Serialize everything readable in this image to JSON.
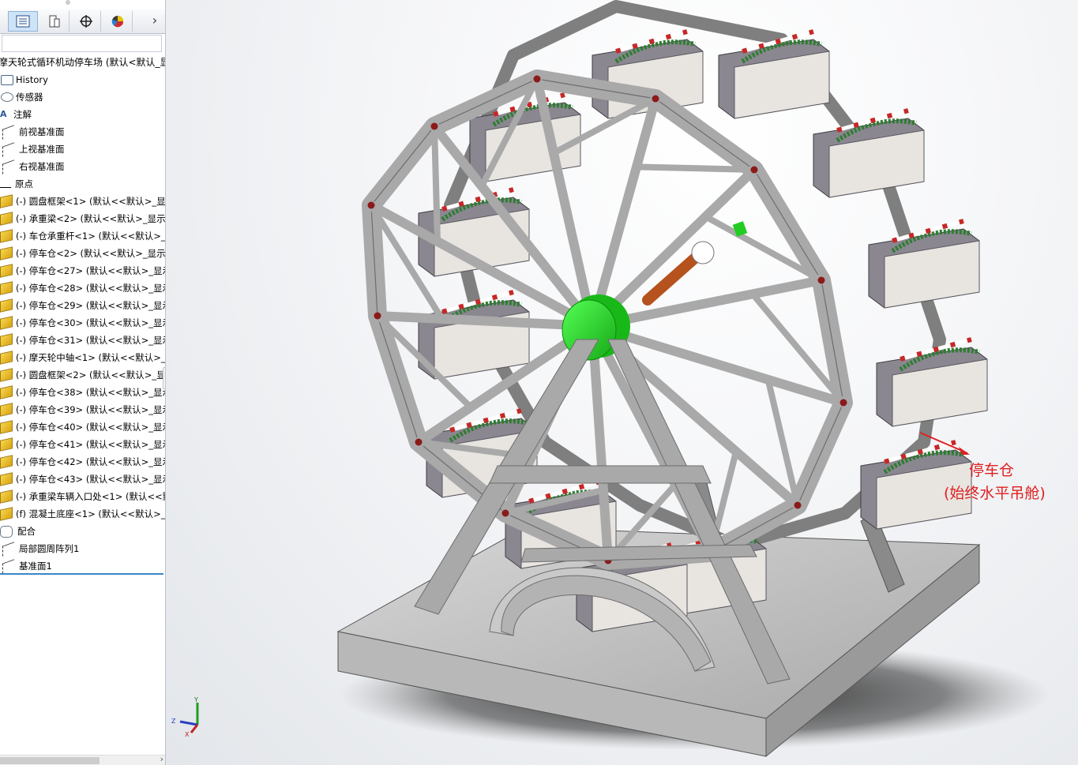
{
  "tree": {
    "title": "摩天轮式循环机动停车场 (默认<默认_显",
    "items": [
      {
        "icon": "history",
        "label": "History"
      },
      {
        "icon": "sensor",
        "label": "传感器"
      },
      {
        "icon": "annotation",
        "label": "注解"
      },
      {
        "icon": "plane",
        "label": "前视基准面"
      },
      {
        "icon": "plane",
        "label": "上视基准面"
      },
      {
        "icon": "plane",
        "label": "右视基准面"
      },
      {
        "icon": "origin",
        "label": "原点"
      },
      {
        "icon": "part",
        "label": "(-) 圆盘框架<1> (默认<<默认>_显"
      },
      {
        "icon": "part",
        "label": "(-) 承重梁<2> (默认<<默认>_显示"
      },
      {
        "icon": "part",
        "label": "(-) 车仓承重杆<1> (默认<<默认>_"
      },
      {
        "icon": "part",
        "label": "(-) 停车仓<2> (默认<<默认>_显示"
      },
      {
        "icon": "part",
        "label": "(-) 停车仓<27> (默认<<默认>_显示"
      },
      {
        "icon": "part",
        "label": "(-) 停车仓<28> (默认<<默认>_显示"
      },
      {
        "icon": "part",
        "label": "(-) 停车仓<29> (默认<<默认>_显示"
      },
      {
        "icon": "part",
        "label": "(-) 停车仓<30> (默认<<默认>_显示"
      },
      {
        "icon": "part",
        "label": "(-) 停车仓<31> (默认<<默认>_显示"
      },
      {
        "icon": "part",
        "label": "(-) 摩天轮中轴<1> (默认<<默认>_"
      },
      {
        "icon": "part",
        "label": "(-) 圆盘框架<2> (默认<<默认>_显"
      },
      {
        "icon": "part",
        "label": "(-) 停车仓<38> (默认<<默认>_显示"
      },
      {
        "icon": "part",
        "label": "(-) 停车仓<39> (默认<<默认>_显示"
      },
      {
        "icon": "part",
        "label": "(-) 停车仓<40> (默认<<默认>_显示"
      },
      {
        "icon": "part",
        "label": "(-) 停车仓<41> (默认<<默认>_显示"
      },
      {
        "icon": "part",
        "label": "(-) 停车仓<42> (默认<<默认>_显示"
      },
      {
        "icon": "part",
        "label": "(-) 停车仓<43> (默认<<默认>_显示"
      },
      {
        "icon": "part",
        "label": "(-) 承重梁车辆入口处<1> (默认<<默"
      },
      {
        "icon": "part",
        "label": "(f) 混凝土底座<1> (默认<<默认>_"
      },
      {
        "icon": "mate",
        "label": "配合"
      },
      {
        "icon": "plane",
        "label": "局部圆周阵列1"
      },
      {
        "icon": "plane",
        "label": "基准面1"
      }
    ]
  },
  "tabs": [
    {
      "name": "feature-manager-tab-icon"
    },
    {
      "name": "property-manager-tab-icon"
    },
    {
      "name": "configuration-manager-tab-icon"
    },
    {
      "name": "display-manager-tab-icon"
    }
  ],
  "callout": {
    "line1": "停车仓",
    "line2": "(始终水平吊舱)",
    "color": "#e02020"
  },
  "triad": {
    "x": "X",
    "y": "Y",
    "z": "Z"
  },
  "colors": {
    "frame": "#a9a9a9",
    "frame_dark": "#7d7d7d",
    "cabin": "#8b8790",
    "hub": "#22dd22",
    "axle": "#b5521d",
    "base": "#c9c9c9"
  }
}
